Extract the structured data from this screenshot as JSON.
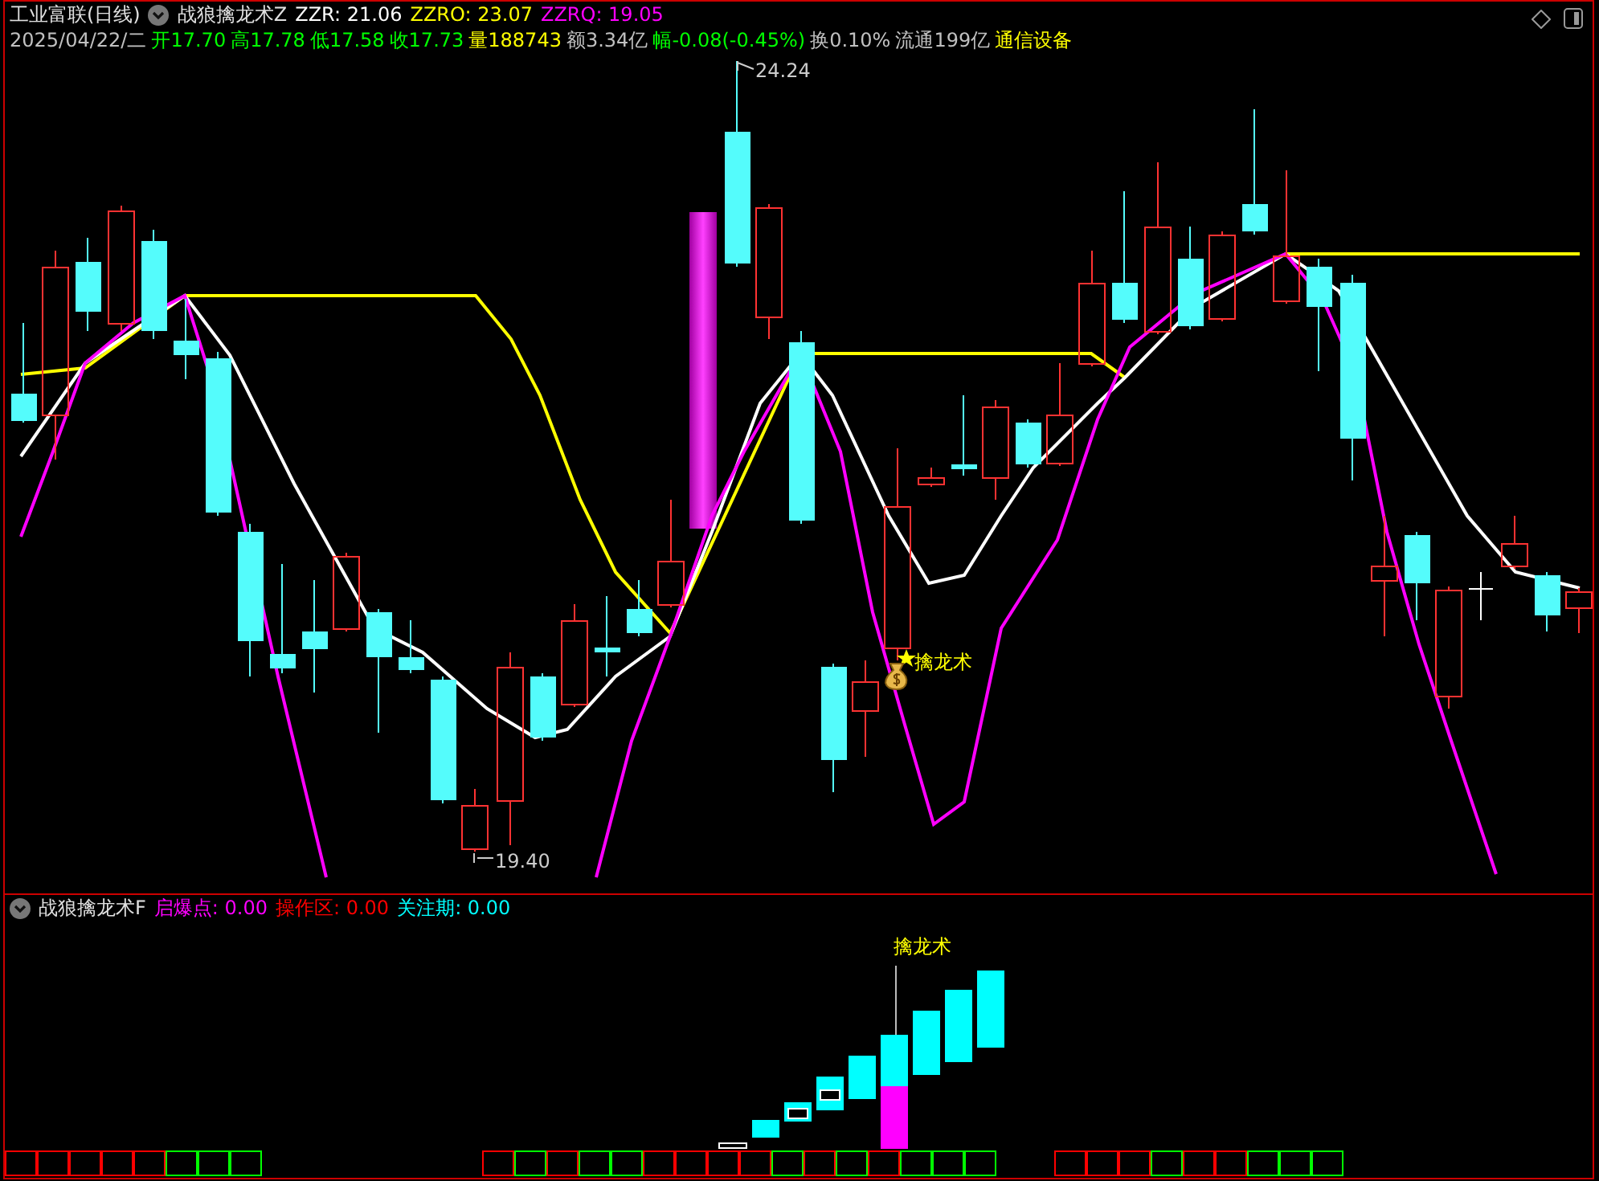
{
  "header": {
    "security": "工业富联(日线)",
    "indicator": "战狼擒龙术Z",
    "values": [
      {
        "text": "ZZR: 21.06",
        "color": "#ffffff"
      },
      {
        "text": "ZZRO: 23.07",
        "color": "#ffff00"
      },
      {
        "text": "ZZRQ: 19.05",
        "color": "#ff00ff"
      }
    ]
  },
  "quote": [
    {
      "text": "2025/04/22/二",
      "color": "#c0c0c0"
    },
    {
      "text": "开17.70",
      "color": "#00ff00"
    },
    {
      "text": "高17.78",
      "color": "#00ff00"
    },
    {
      "text": "低17.58",
      "color": "#00ff00"
    },
    {
      "text": "收17.73",
      "color": "#00ff00"
    },
    {
      "text": "量188743",
      "color": "#ffff00"
    },
    {
      "text": "额3.34亿",
      "color": "#c0c0c0"
    },
    {
      "text": "幅-0.08(-0.45%)",
      "color": "#00ff00"
    },
    {
      "text": "换0.10%",
      "color": "#c0c0c0"
    },
    {
      "text": "流通199亿",
      "color": "#c0c0c0"
    },
    {
      "text": "通信设备",
      "color": "#ffff00"
    }
  ],
  "chart": {
    "high_label": "24.24",
    "low_label": "19.40",
    "signal_label": "擒龙术"
  },
  "indicator": {
    "title": "战狼擒龙术F",
    "values": [
      {
        "text": "启爆点: 0.00",
        "color": "#ff00ff"
      },
      {
        "text": "操作区: 0.00",
        "color": "#ff0000"
      },
      {
        "text": "关注期: 0.00",
        "color": "#00ffff"
      }
    ],
    "signal_label": "擒龙术",
    "signal_groups": [
      {
        "boxes": [
          {
            "color": "#ff0000"
          },
          {
            "color": "#ff0000"
          },
          {
            "color": "#ff0000"
          },
          {
            "color": "#ff0000"
          },
          {
            "color": "#ff0000"
          },
          {
            "color": "#00ff00"
          },
          {
            "color": "#00ff00"
          },
          {
            "color": "#00ff00"
          }
        ]
      },
      {
        "boxes": [
          {
            "color": "#ff0000"
          },
          {
            "color": "#00ff00"
          },
          {
            "color": "#ff0000"
          },
          {
            "color": "#00ff00"
          },
          {
            "color": "#00ff00"
          },
          {
            "color": "#ff0000"
          },
          {
            "color": "#ff0000"
          },
          {
            "color": "#ff0000"
          },
          {
            "color": "#ff0000"
          },
          {
            "color": "#00ff00"
          },
          {
            "color": "#ff0000"
          },
          {
            "color": "#00ff00"
          },
          {
            "color": "#ff0000"
          },
          {
            "color": "#00ff00"
          },
          {
            "color": "#00ff00"
          },
          {
            "color": "#00ff00"
          }
        ]
      },
      {
        "boxes": [
          {
            "color": "#ff0000"
          },
          {
            "color": "#ff0000"
          },
          {
            "color": "#ff0000"
          },
          {
            "color": "#00ff00"
          },
          {
            "color": "#ff0000"
          },
          {
            "color": "#ff0000"
          },
          {
            "color": "#00ff00"
          },
          {
            "color": "#00ff00"
          },
          {
            "color": "#00ff00"
          }
        ]
      }
    ]
  }
}
